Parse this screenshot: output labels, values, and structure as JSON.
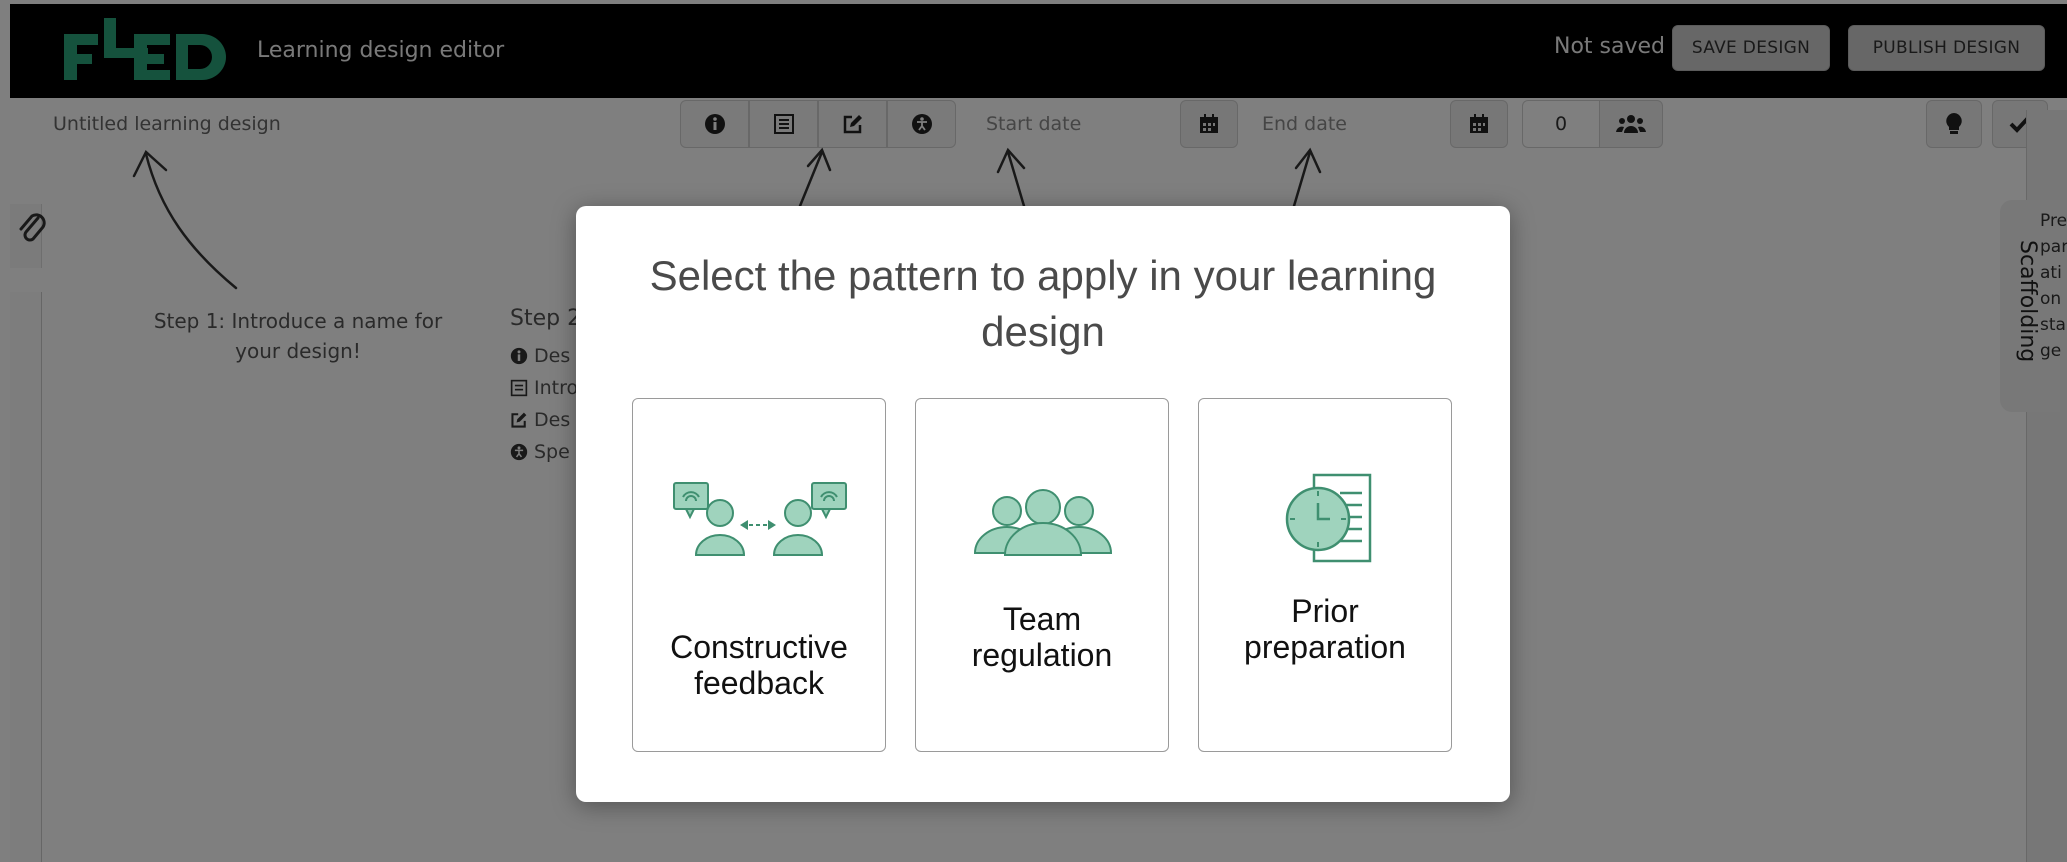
{
  "header": {
    "app_title": "Learning design editor",
    "save_status": "Not saved",
    "save_button": "SAVE DESIGN",
    "publish_button": "PUBLISH DESIGN"
  },
  "toolbar": {
    "design_name_placeholder": "Untitled learning design",
    "start_date_placeholder": "Start date",
    "end_date_placeholder": "End date",
    "participants_count": "0"
  },
  "guide": {
    "step1": "Step 1: Introduce a name for your design!",
    "step2_title": "Step 2",
    "step2_items": [
      "Des",
      "Intro",
      "Des",
      "Spe"
    ]
  },
  "scaffolding": {
    "tab_label": "Scaffolding",
    "stage_text": [
      "Pre",
      "par",
      "ati",
      "on",
      "sta",
      "ge"
    ]
  },
  "modal": {
    "title": "Select the pattern to apply in your learning design",
    "patterns": [
      {
        "label_line1": "Constructive",
        "label_line2": "feedback",
        "icon": "constructive-feedback-icon"
      },
      {
        "label_line1": "Team",
        "label_line2": "regulation",
        "icon": "team-regulation-icon"
      },
      {
        "label_line1": "Prior",
        "label_line2": "preparation",
        "icon": "prior-preparation-icon"
      }
    ]
  },
  "colors": {
    "brand_green": "#2aa57a",
    "icon_green": "#9fd3bd",
    "icon_stroke": "#3f8f70"
  }
}
